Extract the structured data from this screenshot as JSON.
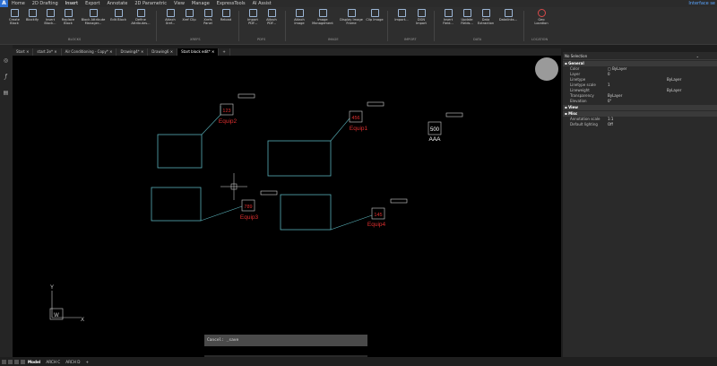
{
  "menu": {
    "logo": "A",
    "tabs": [
      "Home",
      "2D Drafting",
      "Insert",
      "Export",
      "Annotate",
      "2D Parametric",
      "View",
      "Manage",
      "ExpressTools",
      "AI Assist"
    ],
    "active_tab": "Insert",
    "interface_label": "Interface se"
  },
  "ribbon": {
    "buttons": [
      {
        "label": "Create Block"
      },
      {
        "label": "Blockify"
      },
      {
        "label": "Insert Block..."
      },
      {
        "label": "Replace Block"
      },
      {
        "label": "Block Attribute Manager..."
      },
      {
        "label": "Edit Block"
      },
      {
        "label": "Define Attributes..."
      },
      {
        "label": "Attach Xref..."
      },
      {
        "label": "Xref Clip"
      },
      {
        "label": "Xrefs Panel"
      },
      {
        "label": "Reload"
      },
      {
        "label": "Import PDF..."
      },
      {
        "label": "Attach PDF..."
      },
      {
        "label": "Attach Image"
      },
      {
        "label": "Image Management"
      },
      {
        "label": "Display Image Frame"
      },
      {
        "label": "Clip Image"
      },
      {
        "label": "Import..."
      },
      {
        "label": "DGN Import"
      },
      {
        "label": "Insert Field..."
      },
      {
        "label": "Update Fields..."
      },
      {
        "label": "Data Extraction"
      },
      {
        "label": "Datalinks..."
      },
      {
        "label": "Geo Location"
      }
    ],
    "groups": [
      "BLOCKS",
      "XREFS",
      "PDFS",
      "IMAGE",
      "IMPORT",
      "DATA",
      "LOCATION"
    ]
  },
  "doc_tabs": [
    "Start",
    "start 2e*",
    "Air Conditioning - Copy*",
    "Drawing4*",
    "Drawing6",
    "Start block edit*"
  ],
  "active_doc_tab": "Start block edit*",
  "canvas": {
    "equipment": [
      {
        "tag": "Equip2",
        "value": "123"
      },
      {
        "tag": "Equip1",
        "value": "456"
      },
      {
        "tag": "Equip3",
        "value": "789"
      },
      {
        "tag": "Equip4",
        "value": "145"
      }
    ],
    "block_value": "500",
    "block_text": "AAA",
    "ucs": {
      "y": "Y",
      "x": "X",
      "w": "W"
    }
  },
  "properties": {
    "selection": "No Selection",
    "sections": [
      {
        "name": "General",
        "rows": [
          {
            "k": "Color",
            "v": "ByLayer"
          },
          {
            "k": "Layer",
            "v": "0"
          },
          {
            "k": "Linetype",
            "v": "ByLayer"
          },
          {
            "k": "Linetype scale",
            "v": "1"
          },
          {
            "k": "Lineweight",
            "v": "ByLayer"
          },
          {
            "k": "Transparency",
            "v": "ByLayer"
          },
          {
            "k": "Elevation",
            "v": "0\""
          }
        ]
      },
      {
        "name": "View",
        "rows": []
      },
      {
        "name": "Misc",
        "rows": [
          {
            "k": "Annotation scale",
            "v": "1:1"
          },
          {
            "k": "Default lighting",
            "v": "Off"
          }
        ]
      }
    ]
  },
  "command": {
    "history": "Cancel: _save",
    "placeholder": ": Enter command"
  },
  "status": {
    "tabs": [
      "Model",
      "ARCH C",
      "ARCH D"
    ],
    "active": "Model"
  },
  "colors": {
    "accent": "#3a8ee6",
    "tag_red": "#e03030",
    "block_cyan": "#58b0b8"
  }
}
